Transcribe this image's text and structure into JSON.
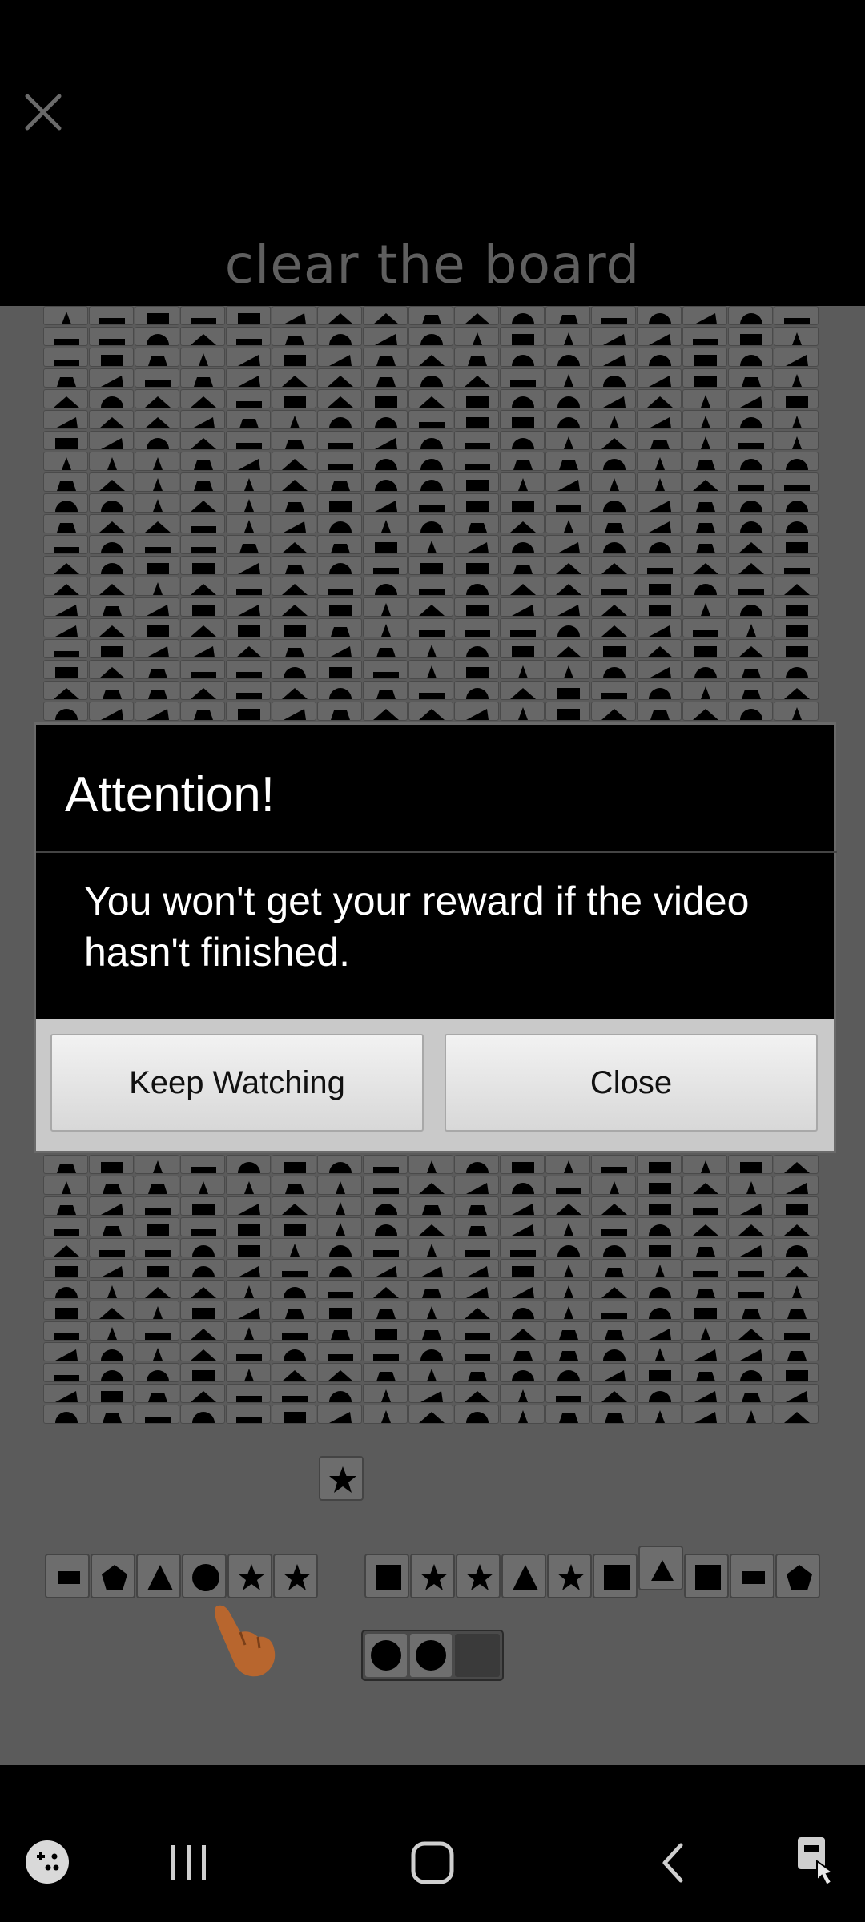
{
  "ad": {
    "close_icon": "close-icon",
    "title": "clear the board"
  },
  "dialog": {
    "title": "Attention!",
    "message": "You won't get your reward if the video hasn't finished.",
    "buttons": {
      "keep_watching": "Keep Watching",
      "close": "Close"
    }
  },
  "game": {
    "bottom_row_shapes": [
      "rect",
      "pentagon",
      "triangle",
      "circle",
      "star",
      "star",
      "gap",
      "square",
      "star",
      "star",
      "triangle",
      "star",
      "square",
      "triangle-raised",
      "square",
      "rect",
      "pentagon"
    ],
    "tray_shapes": [
      "circle",
      "circle"
    ]
  },
  "nav": {
    "icons": [
      "game-launcher-icon",
      "recent-apps-icon",
      "home-icon",
      "back-icon",
      "accessibility-icon"
    ]
  },
  "colors": {
    "overlay_bg": "#000000",
    "dialog_button_bg": "#e6e6e6",
    "title_text": "#5f5f5f"
  }
}
